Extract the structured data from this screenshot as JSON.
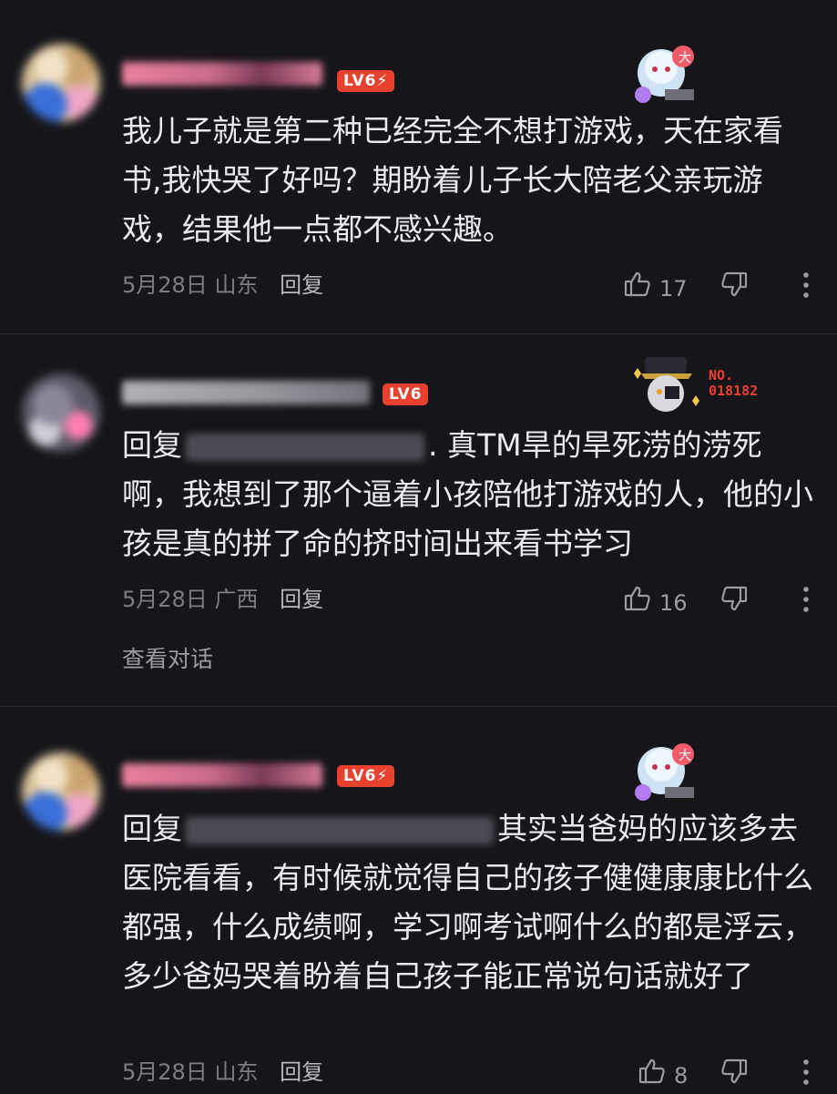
{
  "comments": [
    {
      "level": "LV6",
      "text": "我儿子就是第二种已经完全不想打游戏，天在家看书,我快哭了好吗？期盼着儿子长大陪老父亲玩游戏，结果他一点都不感兴趣。",
      "date": "5月28日",
      "location": "山东",
      "reply_label": "回复",
      "likes": "17"
    },
    {
      "level": "LV6",
      "reply_prefix": "回复",
      "text": ". 真TM旱的旱死涝的涝死啊，我想到了那个逼着小孩陪他打游戏的人，他的小孩是真的拼了命的挤时间出来看书学习",
      "date": "5月28日",
      "location": "广西",
      "reply_label": "回复",
      "likes": "16",
      "ornament_badge_line1": "NO.",
      "ornament_badge_line2": "018182",
      "view_conversation": "查看对话"
    },
    {
      "level": "LV6",
      "reply_prefix": "回复",
      "text": "其实当爸妈的应该多去医院看看，有时候就觉得自己的孩子健健康康比什么都强，什么成绩啊，学习啊考试啊什么的都是浮云，多少爸妈哭着盼着自己孩子能正常说句话就好了",
      "date": "5月28日",
      "location": "山东",
      "reply_label": "回复",
      "likes": "8"
    }
  ],
  "colors": {
    "background": "#16161a",
    "level_badge": "#e8412f",
    "meta_text": "#7d7d86"
  },
  "icons": [
    "thumbs-up-icon",
    "thumbs-down-icon",
    "more-vertical-icon",
    "lightning-icon"
  ]
}
